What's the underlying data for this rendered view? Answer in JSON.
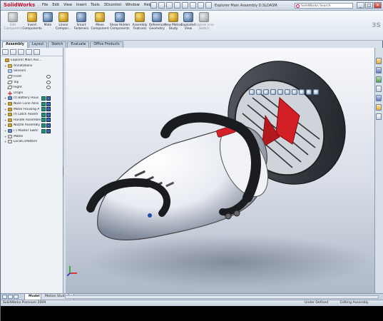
{
  "app": {
    "brand": "SolidWorks",
    "document_title": "Explorer Main Assembly D.SLDASM",
    "search_placeholder": "SolidWorks Search"
  },
  "menu": [
    "File",
    "Edit",
    "View",
    "Insert",
    "Tools",
    "3Dcontrol",
    "Window",
    "Help"
  ],
  "window_controls": {
    "minimize": "_",
    "maximize": "□",
    "close": "✕"
  },
  "commands": [
    {
      "label": "Edit Component",
      "enabled": false
    },
    {
      "label": "Insert Components",
      "enabled": true
    },
    {
      "label": "Mate",
      "enabled": true
    },
    {
      "label": "Linear Compon...",
      "enabled": true
    },
    {
      "label": "Smart Fasteners",
      "enabled": true
    },
    {
      "label": "Move Component",
      "enabled": true
    },
    {
      "label": "Show Hidden Components",
      "enabled": true
    },
    {
      "label": "Assembly Features",
      "enabled": true
    },
    {
      "label": "Reference Geometry",
      "enabled": true
    },
    {
      "label": "New Motion Study",
      "enabled": true
    },
    {
      "label": "Exploded View",
      "enabled": true
    },
    {
      "label": "Explode Line Sketch",
      "enabled": false
    }
  ],
  "tabs": [
    "Assembly",
    "Layout",
    "Sketch",
    "Evaluate",
    "Office Products"
  ],
  "active_tab": "Assembly",
  "tree": [
    {
      "label": "Explorer Main Assem",
      "icon": "asm",
      "toggle": "",
      "indent": 0
    },
    {
      "label": "Annotations",
      "icon": "folder",
      "toggle": "+",
      "indent": 1
    },
    {
      "label": "Sensors",
      "icon": "sensor",
      "toggle": "",
      "indent": 1
    },
    {
      "label": "Front",
      "icon": "plane",
      "toggle": "",
      "indent": 1
    },
    {
      "label": "Top",
      "icon": "plane",
      "toggle": "",
      "indent": 1
    },
    {
      "label": "Right",
      "icon": "plane",
      "toggle": "",
      "indent": 1
    },
    {
      "label": "Origin",
      "icon": "origin",
      "toggle": "",
      "indent": 1
    },
    {
      "label": "(f) Battery Hous",
      "icon": "part",
      "toggle": "+",
      "indent": 1
    },
    {
      "label": "Nose Cone Asse",
      "icon": "asm",
      "toggle": "+",
      "indent": 1
    },
    {
      "label": "Motor Housing A",
      "icon": "asm",
      "toggle": "+",
      "indent": 1
    },
    {
      "label": "(f) Latch Assem",
      "icon": "asm",
      "toggle": "+",
      "indent": 1
    },
    {
      "label": "Handle Assemble",
      "icon": "asm",
      "toggle": "+",
      "indent": 1
    },
    {
      "label": "Nozzle Assembly",
      "icon": "asm",
      "toggle": "+",
      "indent": 1
    },
    {
      "label": "(-) Master Switc",
      "icon": "part",
      "toggle": "+",
      "indent": 1
    },
    {
      "label": "Mates",
      "icon": "mate",
      "toggle": "+",
      "indent": 1
    },
    {
      "label": "LocalCirPattern",
      "icon": "pattern",
      "toggle": "+",
      "indent": 1
    }
  ],
  "bottom_tabs": [
    "Model",
    "Motion Study 1"
  ],
  "status": {
    "product": "SolidWorks Premium 2009",
    "state": "Under Defined",
    "mode": "Editing Assembly"
  }
}
